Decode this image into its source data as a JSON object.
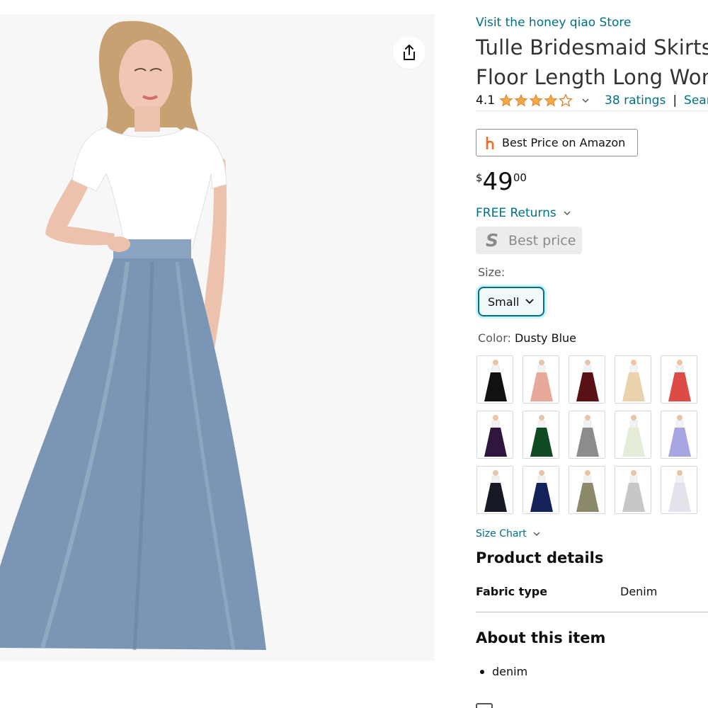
{
  "product": {
    "store_link": "Visit the honey qiao Store",
    "title_line1": "Tulle Bridesmaid Skirts",
    "title_line2": "Floor Length Long Won",
    "rating_value": "4.1",
    "rating_stars": 4.1,
    "ratings_count": "38 ratings",
    "separator": "|",
    "search_link": "Sear",
    "honey_label": "Best Price on Amazon",
    "price": {
      "symbol": "$",
      "whole": "49",
      "fraction": "00"
    },
    "free_returns": "FREE Returns",
    "best_price_badge": {
      "letter": "S",
      "label": "Best price"
    },
    "size_label": "Size:",
    "size_selected": "Small",
    "color_key": "Color:",
    "color_value": "Dusty Blue",
    "swatches": [
      {
        "color": "#111111"
      },
      {
        "color": "#e8a99a"
      },
      {
        "color": "#5a1116"
      },
      {
        "color": "#ead2ac"
      },
      {
        "color": "#dc4b45"
      },
      {
        "color": "#30163f"
      },
      {
        "color": "#0f4a23"
      },
      {
        "color": "#8c8c8c"
      },
      {
        "color": "#e5ecd8"
      },
      {
        "color": "#a7a6e2"
      },
      {
        "color": "#171a26"
      },
      {
        "color": "#13235a"
      },
      {
        "color": "#8d8a6c"
      },
      {
        "color": "#c7c7c7"
      },
      {
        "color": "#e3e3eb"
      }
    ],
    "size_chart": "Size Chart",
    "details_heading": "Product details",
    "fabric_key": "Fabric type",
    "fabric_value": "Denim",
    "about_heading": "About this item",
    "about_items": [
      "denim"
    ]
  },
  "colors": {
    "link": "#007185",
    "star": "#f3a847",
    "skirt": "#7b95b4",
    "image_bg": "#f7f7f7"
  },
  "icons": [
    "share-icon",
    "star-icon",
    "chevron-down-icon",
    "honey-logo-icon"
  ]
}
